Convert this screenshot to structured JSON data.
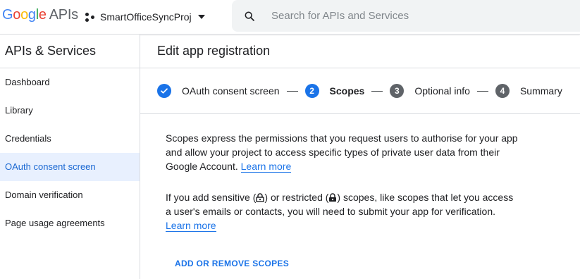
{
  "header": {
    "logo_google": "Google",
    "logo_apis": "APIs",
    "project_name": "SmartOfficeSyncProj",
    "search_placeholder": "Search for APIs and Services"
  },
  "sidebar": {
    "title": "APIs & Services",
    "items": [
      {
        "label": "Dashboard",
        "active": false
      },
      {
        "label": "Library",
        "active": false
      },
      {
        "label": "Credentials",
        "active": false
      },
      {
        "label": "OAuth consent screen",
        "active": true
      },
      {
        "label": "Domain verification",
        "active": false
      },
      {
        "label": "Page usage agreements",
        "active": false
      }
    ]
  },
  "main": {
    "title": "Edit app registration",
    "steps": [
      {
        "number": "",
        "label": "OAuth consent screen",
        "state": "done"
      },
      {
        "number": "2",
        "label": "Scopes",
        "state": "current"
      },
      {
        "number": "3",
        "label": "Optional info",
        "state": "pending"
      },
      {
        "number": "4",
        "label": "Summary",
        "state": "pending"
      }
    ],
    "para1_text": "Scopes express the permissions that you request users to authorise for your app and allow your project to access specific types of private user data from their Google Account.",
    "para1_link": "Learn more",
    "para2_part1": "If you add sensitive (",
    "para2_part2": ") or restricted (",
    "para2_part3": ") scopes, like scopes that let you access a user's emails or contacts, you will need to submit your app for verification.",
    "para2_link": "Learn more",
    "action_button": "ADD OR REMOVE SCOPES"
  },
  "colors": {
    "accent": "#1a73e8",
    "active_nav_bg": "#e8f0fe",
    "pending_step": "#5f6368"
  },
  "icons": {
    "project": "project-icon",
    "search": "search-icon",
    "step_done": "check-icon",
    "sensitive": "lock-open-outline-icon",
    "restricted": "lock-filled-icon"
  }
}
